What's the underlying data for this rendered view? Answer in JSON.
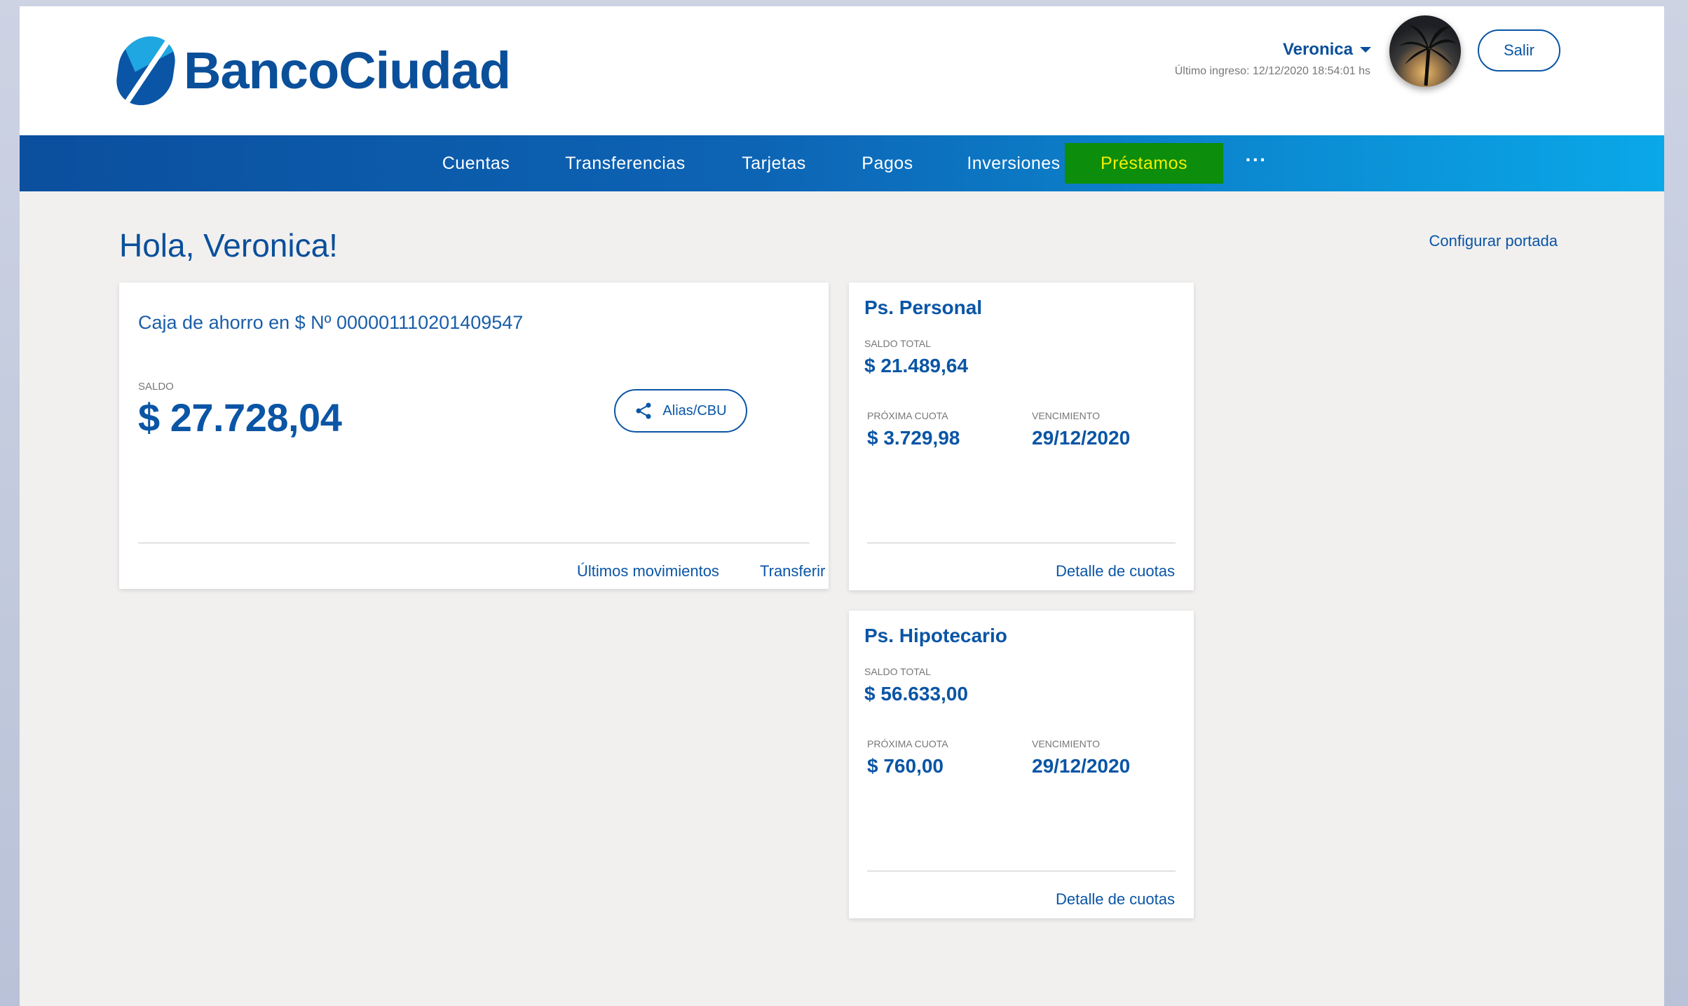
{
  "header": {
    "brand": "BancoCiudad",
    "user_name": "Veronica",
    "last_login": "Último ingreso: 12/12/2020 18:54:01 hs",
    "logout_label": "Salir"
  },
  "nav": {
    "items": [
      "Cuentas",
      "Transferencias",
      "Tarjetas",
      "Pagos",
      "Inversiones",
      "Préstamos"
    ],
    "more": "···",
    "active": "Préstamos"
  },
  "main": {
    "greeting": "Hola, Veronica!",
    "configure_label": "Configurar portada"
  },
  "account": {
    "title": "Caja de ahorro en $ Nº 000001110201409547",
    "balance_label": "SALDO",
    "balance": "$ 27.728,04",
    "alias_label": "Alias/CBU",
    "movements_label": "Últimos movimientos",
    "transfer_label": "Transferir"
  },
  "loans": [
    {
      "title": "Ps. Personal",
      "total_label": "SALDO TOTAL",
      "total": "$ 21.489,64",
      "next_label": "PRÓXIMA CUOTA",
      "next": "$ 3.729,98",
      "due_label": "VENCIMIENTO",
      "due": "29/12/2020",
      "detail_label": "Detalle de cuotas"
    },
    {
      "title": "Ps. Hipotecario",
      "total_label": "SALDO TOTAL",
      "total": "$ 56.633,00",
      "next_label": "PRÓXIMA CUOTA",
      "next": "$ 760,00",
      "due_label": "VENCIMIENTO",
      "due": "29/12/2020",
      "detail_label": "Detalle de cuotas"
    }
  ],
  "colors": {
    "brand_blue": "#0a55a5",
    "active_tab_bg": "#0c8d0c",
    "active_tab_text": "#f3f000"
  }
}
